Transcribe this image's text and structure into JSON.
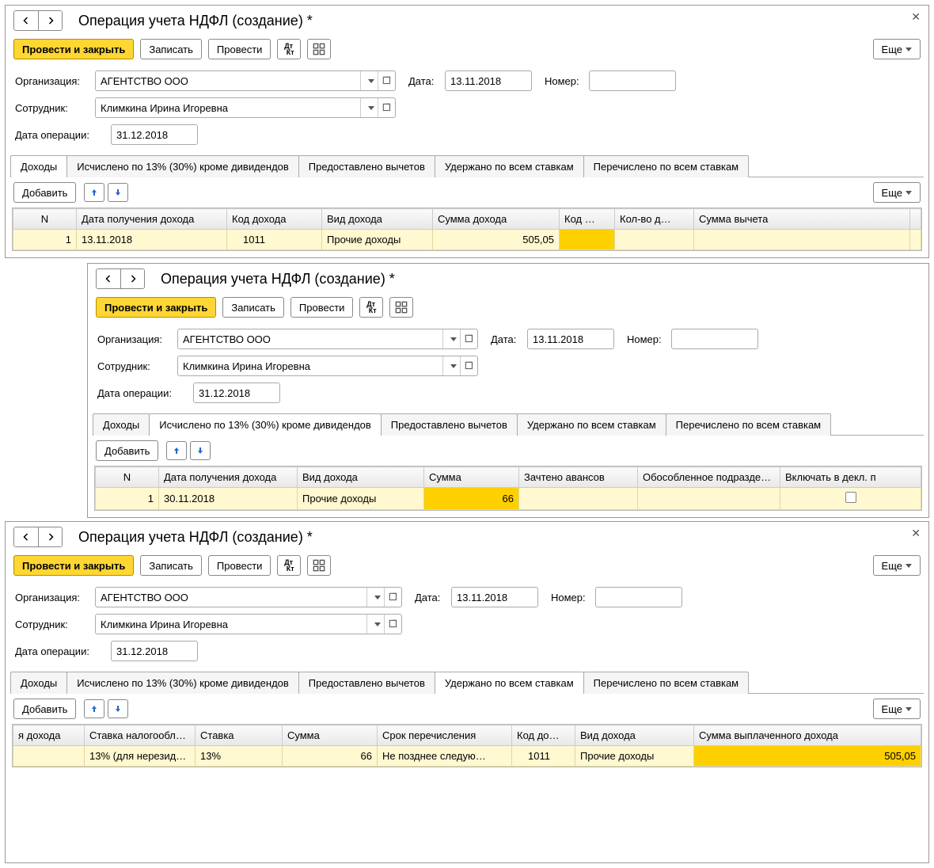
{
  "title": "Операция учета НДФЛ (создание) *",
  "buttons": {
    "post_close": "Провести и закрыть",
    "save": "Записать",
    "post": "Провести",
    "more": "Еще",
    "add": "Добавить"
  },
  "labels": {
    "org": "Организация:",
    "emp": "Сотрудник:",
    "opdate": "Дата операции:",
    "date": "Дата:",
    "num": "Номер:"
  },
  "vals": {
    "org": "АГЕНТСТВО ООО",
    "emp": "Климкина Ирина Игоревна",
    "opdate": "31.12.2018",
    "date": "13.11.2018",
    "num": ""
  },
  "tabs": {
    "income": "Доходы",
    "calc": "Исчислено по 13% (30%) кроме дивидендов",
    "deduct": "Предоставлено вычетов",
    "withheld": "Удержано по всем ставкам",
    "transferred": "Перечислено по всем ставкам"
  },
  "p1": {
    "headers": {
      "n": "N",
      "date": "Дата получения дохода",
      "code": "Код дохода",
      "type": "Вид дохода",
      "sum": "Сумма дохода",
      "kod": "Код …",
      "kolvo": "Кол-во д…",
      "vychet": "Сумма вычета"
    },
    "row": {
      "n": "1",
      "date": "13.11.2018",
      "code": "1011",
      "type": "Прочие доходы",
      "sum": "505,05"
    }
  },
  "p2": {
    "headers": {
      "n": "N",
      "date": "Дата получения дохода",
      "type": "Вид дохода",
      "sum": "Сумма",
      "zach": "Зачтено авансов",
      "podr": "Обособленное подразде…",
      "dekl": "Включать в декл. п"
    },
    "row": {
      "n": "1",
      "date": "30.11.2018",
      "type": "Прочие доходы",
      "sum": "66"
    }
  },
  "p3": {
    "headers": {
      "ya": "я дохода",
      "stavkan": "Ставка налогообл…",
      "stavka": "Ставка",
      "sum": "Сумма",
      "srok": "Срок перечисления",
      "koddo": "Код до…",
      "vid": "Вид дохода",
      "sumv": "Сумма выплаченного дохода"
    },
    "row": {
      "stavkan": "13% (для нерезид…",
      "stavka": "13%",
      "sum": "66",
      "srok": "Не позднее следую…",
      "koddo": "1011",
      "vid": "Прочие доходы",
      "sumv": "505,05"
    }
  }
}
